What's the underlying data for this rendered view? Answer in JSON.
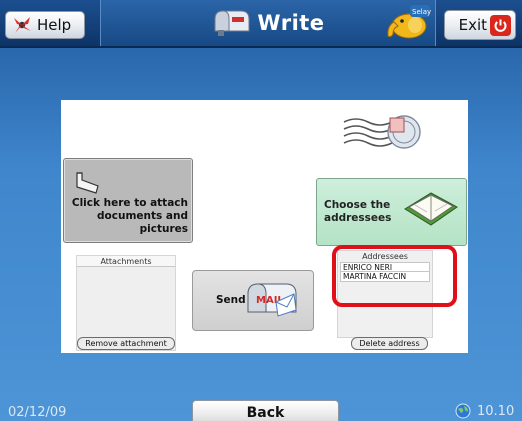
{
  "header": {
    "help_label": "Help",
    "title": "Write",
    "exit_label": "Exit",
    "brand_icon_text": "Selay"
  },
  "panel": {
    "attach_label_line1": "Click here to attach",
    "attach_label_line2": "documents and pictures",
    "choose_label_line1": "Choose the",
    "choose_label_line2": "addressees",
    "attachments_header": "Attachments",
    "remove_label": "Remove attachment",
    "send_label": "Send",
    "send_icon_text": "MAIL",
    "addressees_header": "Addressees",
    "addressees": [
      "ENRICO NERI",
      "MARTINA FACCIN"
    ],
    "delete_label": "Delete address"
  },
  "footer": {
    "date": "02/12/09",
    "back_label": "Back",
    "version": "10.10"
  },
  "colors": {
    "background": "#3f86cc",
    "choose_button": "#b5e3c6",
    "highlight": "#e0101a"
  }
}
